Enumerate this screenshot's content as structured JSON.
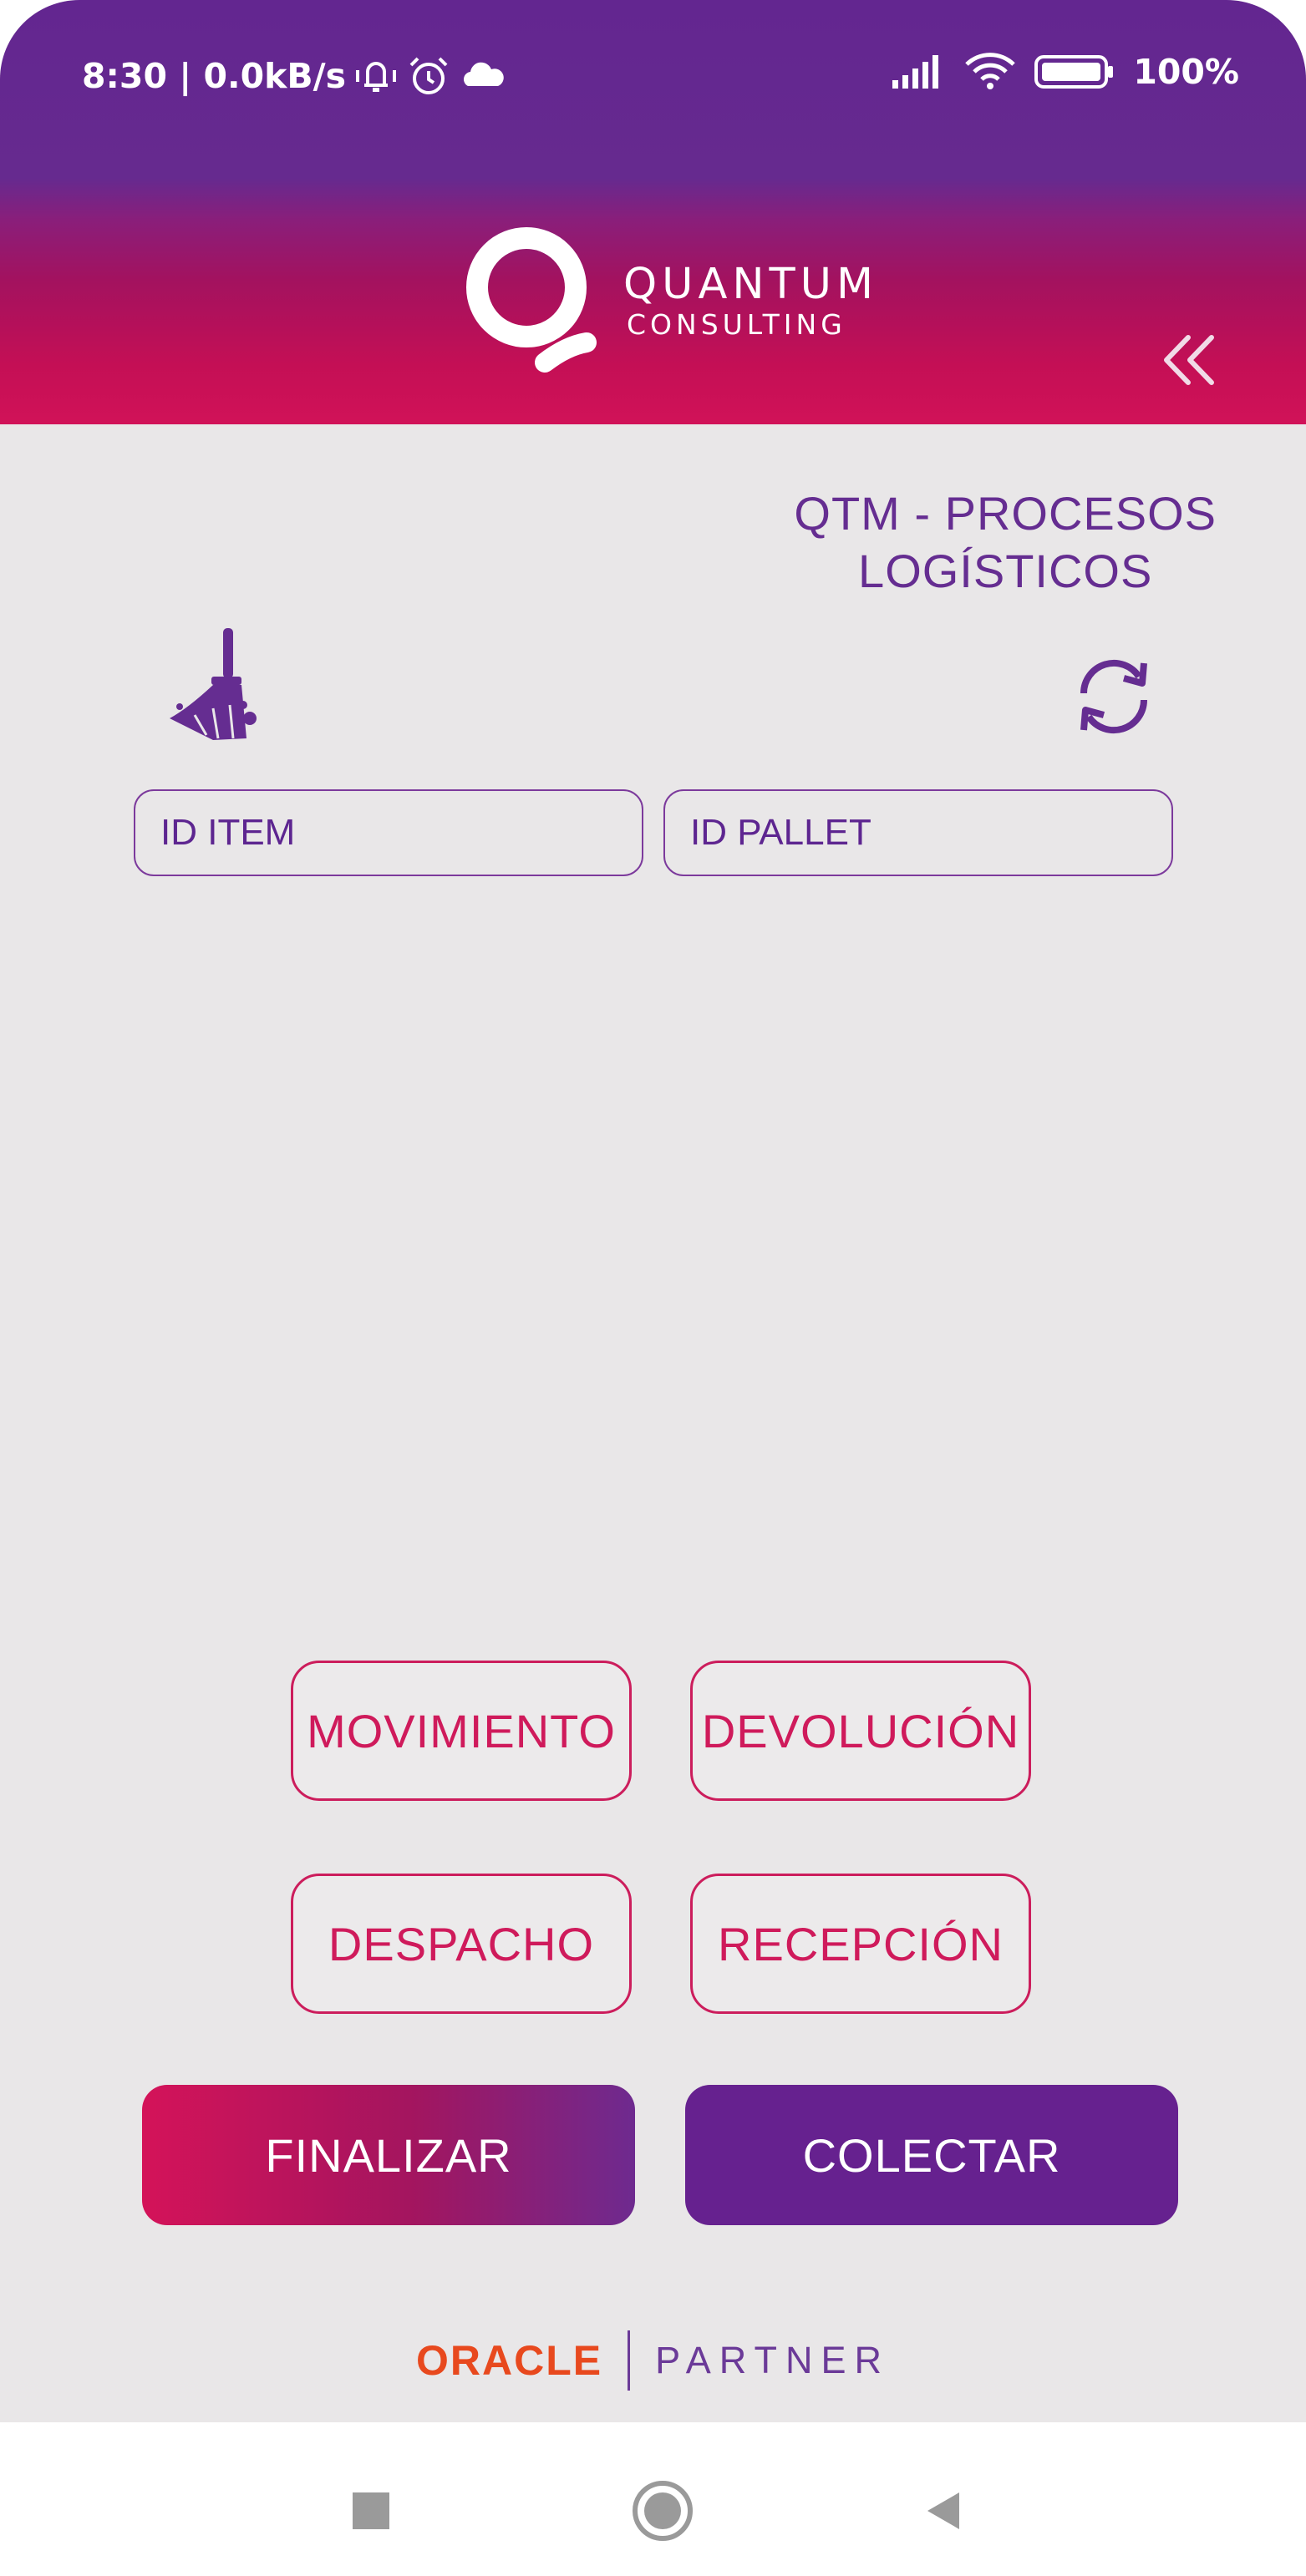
{
  "status_bar": {
    "left_text": "8:30 | 0.0kB/s",
    "battery_text": "100%",
    "icons": [
      "vibrate-icon",
      "alarm-icon",
      "cloud-icon",
      "signal-icon",
      "wifi-icon",
      "battery-icon"
    ]
  },
  "header": {
    "logo_line1": "QUANTUM",
    "logo_line2": "CONSULTING",
    "back_icon": "double-chevron-left-icon"
  },
  "app": {
    "title_line1": "QTM - PROCESOS",
    "title_line2": "LOGÍSTICOS",
    "clean_icon": "broom-icon",
    "refresh_icon": "refresh-icon"
  },
  "inputs": {
    "item_placeholder": "ID ITEM",
    "pallet_placeholder": "ID PALLET"
  },
  "process_buttons": {
    "movimiento": "MOVIMIENTO",
    "devolucion": "DEVOLUCIÓN",
    "despacho": "DESPACHO",
    "recepcion": "RECEPCIÓN"
  },
  "actions": {
    "finalizar": "FINALIZAR",
    "colectar": "COLECTAR"
  },
  "footer": {
    "oracle": "ORACLE",
    "partner": "PARTNER"
  },
  "colors": {
    "purple": "#652d91",
    "magenta": "#cf1a5b",
    "oracle_red": "#e8491e",
    "background": "#e9e7e8"
  },
  "navbar": {
    "icons": [
      "recent-apps-icon",
      "home-icon",
      "back-icon"
    ]
  }
}
